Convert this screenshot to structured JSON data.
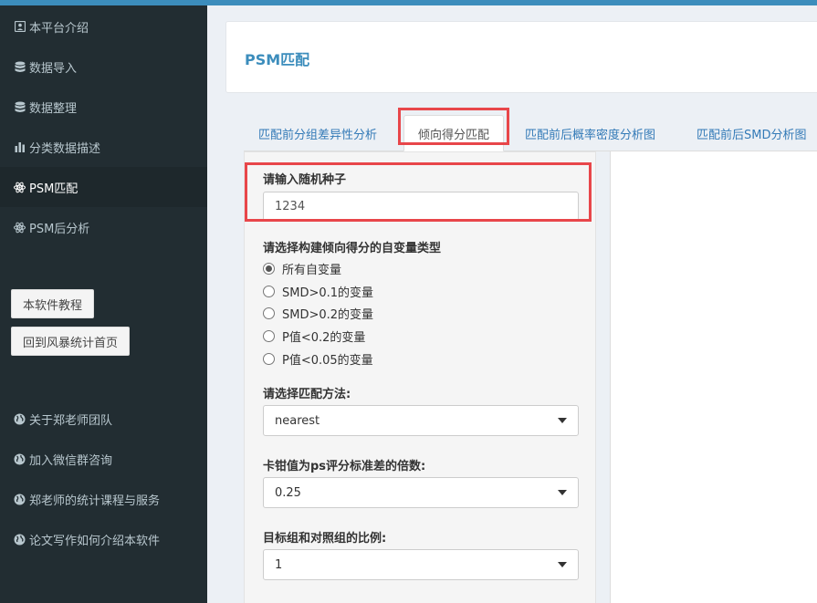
{
  "sidebar": {
    "items": [
      {
        "label": "本平台介绍",
        "icon": "id-card-icon"
      },
      {
        "label": "数据导入",
        "icon": "database-icon"
      },
      {
        "label": "数据整理",
        "icon": "database-icon"
      },
      {
        "label": "分类数据描述",
        "icon": "bar-chart-icon"
      },
      {
        "label": "PSM匹配",
        "icon": "atom-icon",
        "active": true
      },
      {
        "label": "PSM后分析",
        "icon": "atom-icon"
      }
    ],
    "buttons": [
      "本软件教程",
      "回到风暴统计首页"
    ],
    "links": [
      {
        "label": "关于郑老师团队",
        "icon": "globe-icon"
      },
      {
        "label": "加入微信群咨询",
        "icon": "globe-icon"
      },
      {
        "label": "郑老师的统计课程与服务",
        "icon": "globe-icon"
      },
      {
        "label": "论文写作如何介绍本软件",
        "icon": "globe-icon"
      }
    ]
  },
  "main": {
    "title": "PSM匹配",
    "tabs": [
      {
        "label": "匹配前分组差异性分析"
      },
      {
        "label": "倾向得分匹配",
        "active": true
      },
      {
        "label": "匹配前后概率密度分析图"
      },
      {
        "label": "匹配前后SMD分析图"
      }
    ],
    "form": {
      "seed_label": "请输入随机种子",
      "seed_value": "1234",
      "vartype_label": "请选择构建倾向得分的自变量类型",
      "vartype_options": [
        "所有自变量",
        "SMD>0.1的变量",
        "SMD>0.2的变量",
        "P值<0.2的变量",
        "P值<0.05的变量"
      ],
      "vartype_selected": 0,
      "method_label": "请选择匹配方法:",
      "method_value": "nearest",
      "caliper_label": "卡钳值为ps评分标准差的倍数:",
      "caliper_value": "0.25",
      "ratio_label": "目标组和对照组的比例:",
      "ratio_value": "1"
    }
  },
  "colors": {
    "sidebar_bg": "#222d32",
    "accent": "#3c8dbc",
    "highlight": "#e8464a"
  }
}
